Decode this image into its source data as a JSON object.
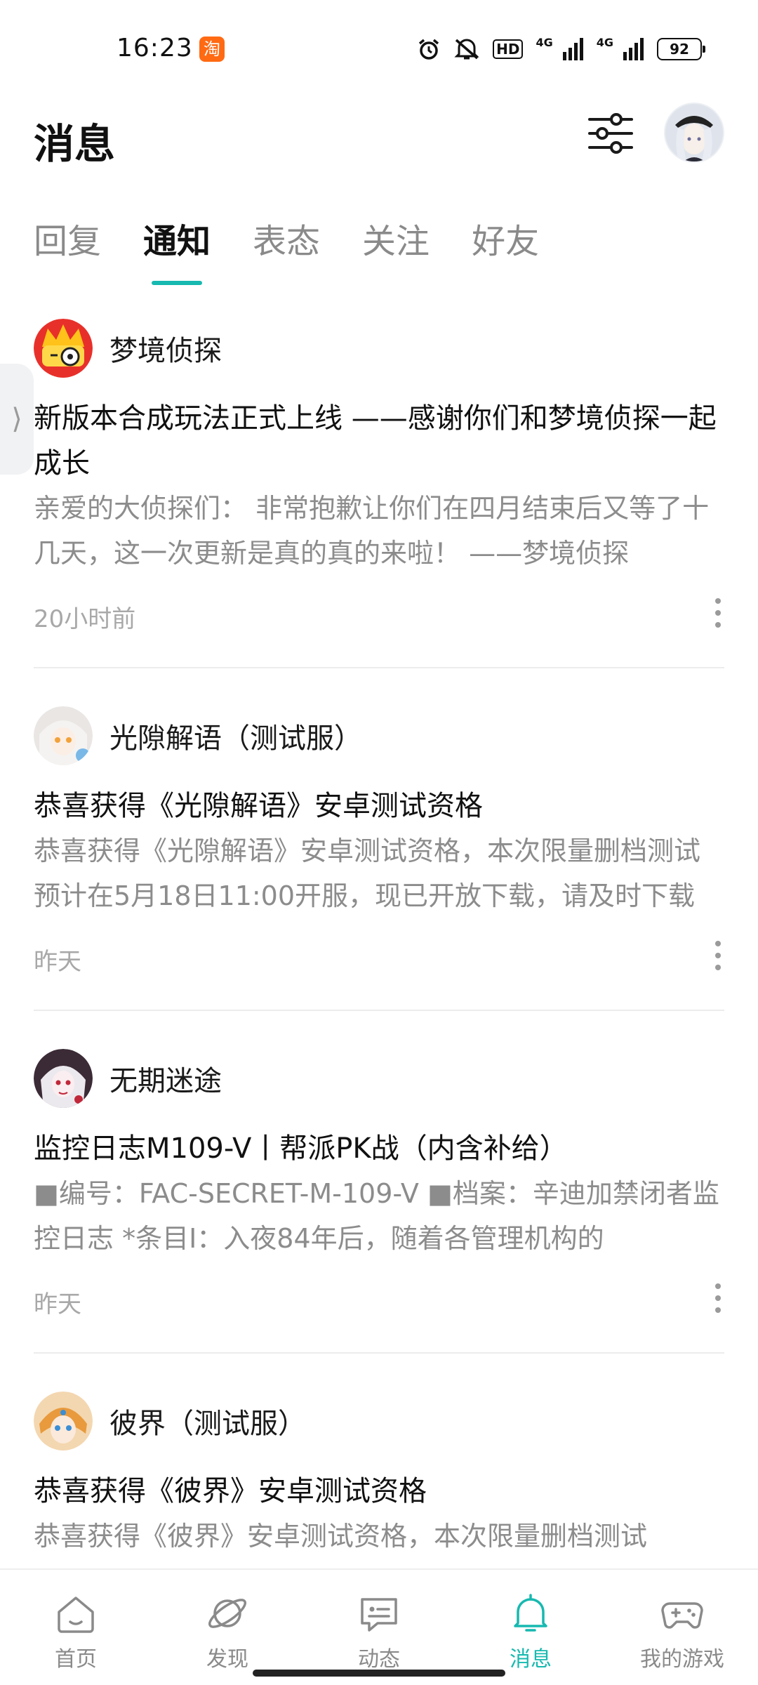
{
  "status_bar": {
    "time": "16:23",
    "taobao_badge": "淘",
    "network_1": "4G",
    "network_2": "4G",
    "battery": "92"
  },
  "header": {
    "title": "消息"
  },
  "tabs": [
    {
      "label": "回复"
    },
    {
      "label": "通知"
    },
    {
      "label": "表态"
    },
    {
      "label": "关注"
    },
    {
      "label": "好友"
    }
  ],
  "active_tab": "通知",
  "side_handle": "⟩",
  "notifications": [
    {
      "sender": "梦境侦探",
      "title": "新版本合成玩法正式上线 ——感谢你们和梦境侦探一起成长",
      "body": "亲爱的大侦探们： 非常抱歉让你们在四月结束后又等了十几天，这一次更新是真的真的来啦！ ——梦境侦探",
      "time": "20小时前"
    },
    {
      "sender": "光隙解语（测试服）",
      "title": "恭喜获得《光隙解语》安卓测试资格",
      "body": "恭喜获得《光隙解语》安卓测试资格，本次限量删档测试预计在5月18日11:00开服，现已开放下载，请及时下载",
      "time": "昨天"
    },
    {
      "sender": "无期迷途",
      "title": "监控日志M109-V丨帮派PK战（内含补给）",
      "body": "■编号：FAC-SECRET-M-109-V ■档案：辛迪加禁闭者监控日志 *条目I：入夜84年后，随着各管理机构的",
      "time": "昨天"
    },
    {
      "sender": "彼界（测试服）",
      "title": "恭喜获得《彼界》安卓测试资格",
      "body": "恭喜获得《彼界》安卓测试资格，本次限量删档测试",
      "time": ""
    }
  ],
  "bottom_nav": [
    {
      "label": "首页",
      "icon": "home-icon"
    },
    {
      "label": "发现",
      "icon": "planet-icon"
    },
    {
      "label": "动态",
      "icon": "chat-icon"
    },
    {
      "label": "消息",
      "icon": "bell-icon"
    },
    {
      "label": "我的游戏",
      "icon": "gamepad-icon"
    }
  ],
  "colors": {
    "accent": "#17b9b0",
    "text_primary": "#111111",
    "text_secondary": "#8c8c8c",
    "divider": "#ececec"
  }
}
